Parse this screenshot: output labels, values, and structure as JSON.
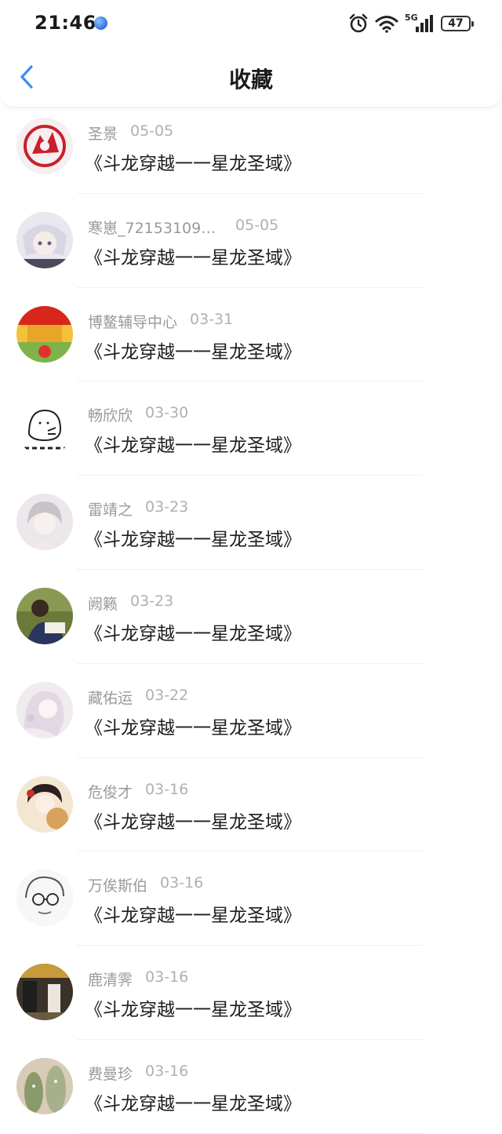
{
  "status": {
    "time": "21:46",
    "network": "5G",
    "battery": "47"
  },
  "header": {
    "title": "收藏"
  },
  "favorites": [
    {
      "user": "圣景",
      "date": "05-05",
      "title": "《斗龙穿越一一星龙圣域》"
    },
    {
      "user": "寒崽_721531099...",
      "date": "05-05",
      "title": "《斗龙穿越一一星龙圣域》"
    },
    {
      "user": "博鳌辅导中心",
      "date": "03-31",
      "title": "《斗龙穿越一一星龙圣域》"
    },
    {
      "user": "畅欣欣",
      "date": "03-30",
      "title": "《斗龙穿越一一星龙圣域》"
    },
    {
      "user": "雷靖之",
      "date": "03-23",
      "title": "《斗龙穿越一一星龙圣域》"
    },
    {
      "user": "阙籁",
      "date": "03-23",
      "title": "《斗龙穿越一一星龙圣域》"
    },
    {
      "user": "藏佑运",
      "date": "03-22",
      "title": "《斗龙穿越一一星龙圣域》"
    },
    {
      "user": "危俊才",
      "date": "03-16",
      "title": "《斗龙穿越一一星龙圣域》"
    },
    {
      "user": "万俟斯伯",
      "date": "03-16",
      "title": "《斗龙穿越一一星龙圣域》"
    },
    {
      "user": "鹿清霁",
      "date": "03-16",
      "title": "《斗龙穿越一一星龙圣域》"
    },
    {
      "user": "费曼珍",
      "date": "03-16",
      "title": "《斗龙穿越一一星龙圣域》"
    }
  ],
  "colors": {
    "accent": "#3a8ef0",
    "text_primary": "#1e1e1e",
    "text_secondary": "#9a9a9a"
  },
  "icons": {
    "back": "chevron-left-icon",
    "alarm": "alarm-clock-icon",
    "wifi": "wifi-icon",
    "signal": "cellular-signal-icon",
    "battery": "battery-icon"
  }
}
